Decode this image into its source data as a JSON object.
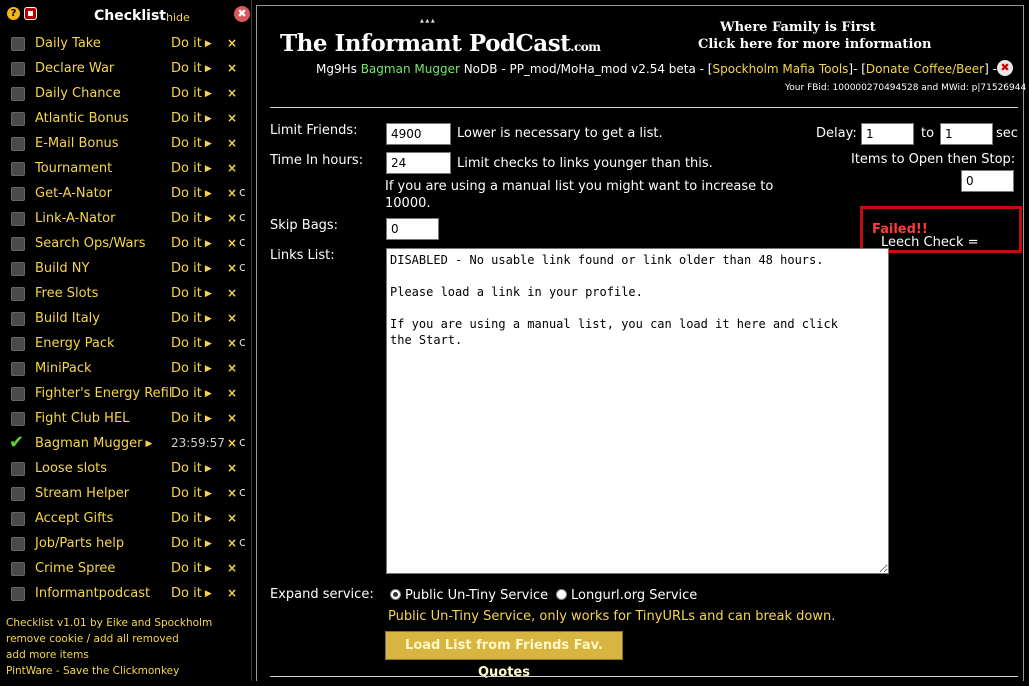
{
  "sidebar": {
    "title": "Checklist",
    "hide_label": "hide",
    "items": [
      {
        "label": "Daily Take",
        "action": "Do it",
        "x": "×",
        "refresh": ""
      },
      {
        "label": "Declare War",
        "action": "Do it",
        "x": "×",
        "refresh": ""
      },
      {
        "label": "Daily Chance",
        "action": "Do it",
        "x": "×",
        "refresh": ""
      },
      {
        "label": "Atlantic Bonus",
        "action": "Do it",
        "x": "×",
        "refresh": ""
      },
      {
        "label": "E-Mail Bonus",
        "action": "Do it",
        "x": "×",
        "refresh": ""
      },
      {
        "label": "Tournament",
        "action": "Do it",
        "x": "×",
        "refresh": ""
      },
      {
        "label": "Get-A-Nator",
        "action": "Do it",
        "x": "×",
        "refresh": "c"
      },
      {
        "label": "Link-A-Nator",
        "action": "Do it",
        "x": "×",
        "refresh": "c"
      },
      {
        "label": "Search Ops/Wars",
        "action": "Do it",
        "x": "×",
        "refresh": "c"
      },
      {
        "label": "Build NY",
        "action": "Do it",
        "x": "×",
        "refresh": "c"
      },
      {
        "label": "Free Slots",
        "action": "Do it",
        "x": "×",
        "refresh": ""
      },
      {
        "label": "Build Italy",
        "action": "Do it",
        "x": "×",
        "refresh": ""
      },
      {
        "label": "Energy Pack",
        "action": "Do it",
        "x": "×",
        "refresh": "c"
      },
      {
        "label": "MiniPack",
        "action": "Do it",
        "x": "×",
        "refresh": ""
      },
      {
        "label": "Fighter's Energy Refil",
        "action": "Do it",
        "x": "×",
        "refresh": ""
      },
      {
        "label": "Fight Club HEL",
        "action": "Do it",
        "x": "×",
        "refresh": ""
      },
      {
        "label": "Bagman Mugger",
        "action": "",
        "timer": "23:59:57",
        "checked": true,
        "x": "×",
        "refresh": "c"
      },
      {
        "label": "Loose slots",
        "action": "Do it",
        "x": "×",
        "refresh": ""
      },
      {
        "label": "Stream Helper",
        "action": "Do it",
        "x": "×",
        "refresh": "c"
      },
      {
        "label": "Accept Gifts",
        "action": "Do it",
        "x": "×",
        "refresh": ""
      },
      {
        "label": "Job/Parts help",
        "action": "Do it",
        "x": "×",
        "refresh": "c"
      },
      {
        "label": "Crime Spree",
        "action": "Do it",
        "x": "×",
        "refresh": ""
      },
      {
        "label": "Informantpodcast",
        "action": "Do it",
        "x": "×",
        "refresh": ""
      }
    ],
    "footer": {
      "version": "Checklist v1.01 by Eike and Spockholm",
      "remove_cookie": "remove cookie",
      "sep": " / ",
      "add_all_removed": "add all removed",
      "add_more": "add more items",
      "pintware": "PintWare - Save the Clickmonkey"
    }
  },
  "banner": {
    "logo_main": "The Informant PodCast",
    "logo_suffix": ".com",
    "tagline": "Where Family is First",
    "more_info": "Click here for more information"
  },
  "info": {
    "prefix": "Mg9Hs ",
    "tool": "Bagman Mugger",
    "mid": " NoDB - PP_mod/MoHa_mod v2.54 beta - [",
    "link1": "Spockholm Mafia Tools",
    "between": "]- [",
    "link2": "Donate Coffee/Beer",
    "suffix": "] -",
    "fbid": "Your FBid: 100000270494528 and MWid: p|71526944"
  },
  "form": {
    "limit_friends_label": "Limit Friends:",
    "limit_friends_value": "4900",
    "limit_friends_note": "Lower is necessary to get a list.",
    "time_label": "Time In hours:",
    "time_value": "24",
    "time_note": "Limit checks to links younger than this.",
    "manual_note_1": "If you are using a manual list you might want to increase to",
    "manual_note_2": "10000.",
    "delay_label": "Delay:",
    "delay_from": "1",
    "delay_to_label": "to",
    "delay_to": "1",
    "delay_unit": "sec",
    "items_label": "Items to Open then Stop:",
    "items_value": "0",
    "skip_label": "Skip Bags:",
    "skip_value": "0",
    "leech_label": "Leech Check = ",
    "leech_status": "Failed!!",
    "links_label": "Links List:",
    "links_text": "DISABLED - No usable link found or link older than 48 hours.\n\nPlease load a link in your profile.\n\nIf you are using a manual list, you can load it here and click\nthe Start.",
    "expand_label": "Expand service:",
    "option1": "Public Un-Tiny Service",
    "option2": "Longurl.org Service",
    "service_note": "Public Un-Tiny Service, only works for TinyURLs and can break down.",
    "load_button": "Load List from Friends Fav. Quotes"
  },
  "colors": {
    "accent_yellow": "#f5d64b",
    "success_green": "#76e76b",
    "fail_red": "#ff3b3b",
    "frame_red": "#c20e0e"
  }
}
